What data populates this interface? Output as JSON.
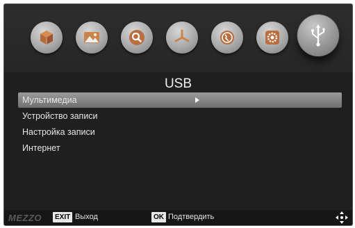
{
  "top_icons": [
    {
      "name": "multimedia-cube-icon",
      "selected": false
    },
    {
      "name": "picture-icon",
      "selected": false
    },
    {
      "name": "search-icon",
      "selected": false
    },
    {
      "name": "channels-icon",
      "selected": false
    },
    {
      "name": "globe-icon",
      "selected": false
    },
    {
      "name": "gear-icon",
      "selected": false
    },
    {
      "name": "usb-icon",
      "selected": true
    }
  ],
  "page": {
    "title": "USB"
  },
  "menu": {
    "items": [
      {
        "label": "Мультимедиа",
        "selected": true
      },
      {
        "label": "Устройство записи",
        "selected": false
      },
      {
        "label": "Настройка записи",
        "selected": false
      },
      {
        "label": "Интернет",
        "selected": false
      }
    ]
  },
  "footer": {
    "brand": "MEZZO",
    "exit_key": "EXIT",
    "exit_label": "Выход",
    "ok_key": "OK",
    "ok_label": "Подтвердить",
    "nav_icon": "dpad-arrows-icon"
  },
  "colors": {
    "background": "#1f1f1f",
    "selection": "#8a8a8a",
    "text": "#e6e6e6"
  }
}
